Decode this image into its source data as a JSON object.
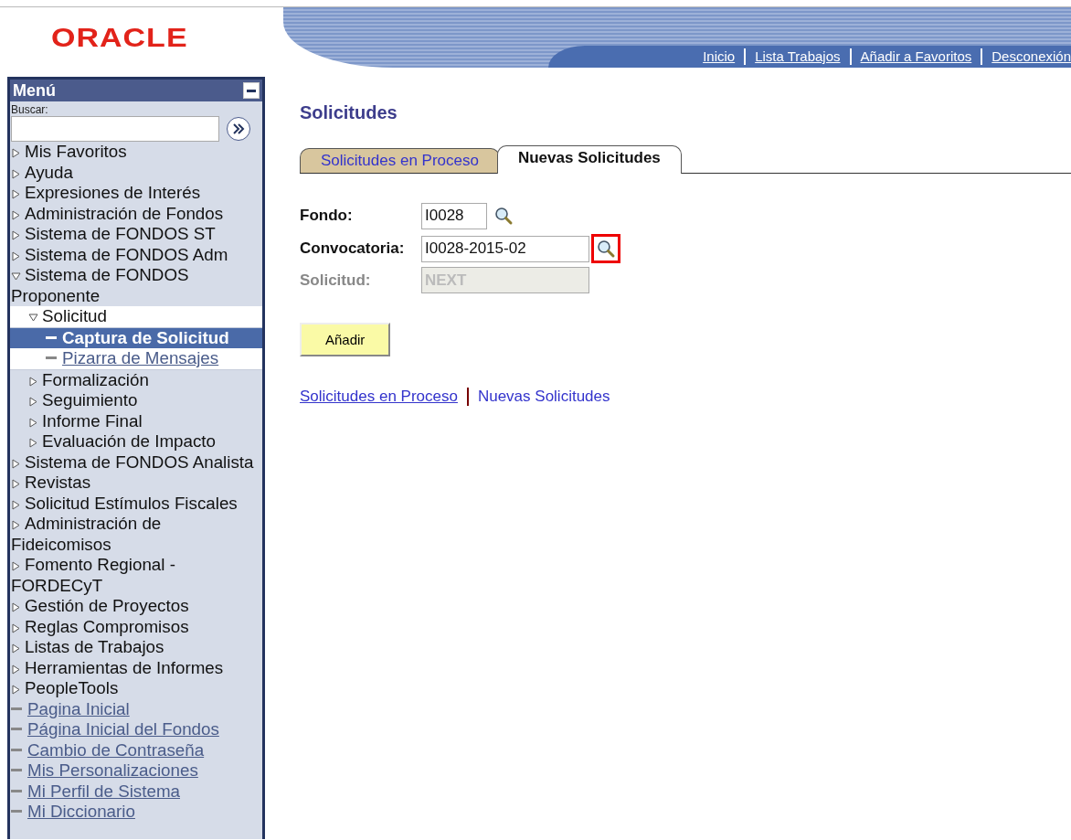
{
  "header": {
    "logo": "ORACLE",
    "links": [
      "Inicio",
      "Lista Trabajos",
      "Añadir a Favoritos",
      "Desconexión"
    ]
  },
  "menu": {
    "title": "Menú",
    "search_label": "Buscar:",
    "items": [
      {
        "label": "Mis Favoritos",
        "kind": "folder",
        "expanded": false,
        "selected": false
      },
      {
        "label": "Ayuda",
        "kind": "folder",
        "expanded": false,
        "selected": false
      },
      {
        "label": "Expresiones de Interés",
        "kind": "folder",
        "expanded": false,
        "selected": false
      },
      {
        "label": "Administración de Fondos",
        "kind": "folder",
        "expanded": false,
        "selected": false
      },
      {
        "label": "Sistema de FONDOS ST",
        "kind": "folder",
        "expanded": false,
        "selected": false
      },
      {
        "label": "Sistema de FONDOS Adm",
        "kind": "folder",
        "expanded": false,
        "selected": false
      },
      {
        "label": "Sistema de FONDOS Proponente",
        "kind": "folder",
        "expanded": true,
        "selected": false,
        "children": [
          {
            "label": "Solicitud",
            "kind": "folder",
            "expanded": true,
            "selected": false,
            "children": [
              {
                "label": "Captura de Solicitud",
                "kind": "link",
                "selected": true
              },
              {
                "label": "Pizarra de Mensajes",
                "kind": "link",
                "selected": false
              }
            ]
          },
          {
            "label": "Formalización",
            "kind": "folder",
            "expanded": false,
            "selected": false
          },
          {
            "label": "Seguimiento",
            "kind": "folder",
            "expanded": false,
            "selected": false
          },
          {
            "label": "Informe Final",
            "kind": "folder",
            "expanded": false,
            "selected": false
          },
          {
            "label": "Evaluación de Impacto",
            "kind": "folder",
            "expanded": false,
            "selected": false
          }
        ]
      },
      {
        "label": "Sistema de FONDOS Analista",
        "kind": "folder",
        "expanded": false,
        "selected": false
      },
      {
        "label": "Revistas",
        "kind": "folder",
        "expanded": false,
        "selected": false
      },
      {
        "label": "Solicitud Estímulos Fiscales",
        "kind": "folder",
        "expanded": false,
        "selected": false
      },
      {
        "label": "Administración de Fideicomisos",
        "kind": "folder",
        "expanded": false,
        "selected": false
      },
      {
        "label": "Fomento Regional - FORDECyT",
        "kind": "folder",
        "expanded": false,
        "selected": false
      },
      {
        "label": "Gestión de Proyectos",
        "kind": "folder",
        "expanded": false,
        "selected": false
      },
      {
        "label": "Reglas Compromisos",
        "kind": "folder",
        "expanded": false,
        "selected": false
      },
      {
        "label": "Listas de Trabajos",
        "kind": "folder",
        "expanded": false,
        "selected": false
      },
      {
        "label": "Herramientas de Informes",
        "kind": "folder",
        "expanded": false,
        "selected": false
      },
      {
        "label": "PeopleTools",
        "kind": "folder",
        "expanded": false,
        "selected": false
      },
      {
        "label": "Pagina Inicial",
        "kind": "link",
        "selected": false
      },
      {
        "label": "Página Inicial del Fondos",
        "kind": "link",
        "selected": false
      },
      {
        "label": "Cambio de Contraseña",
        "kind": "link",
        "selected": false
      },
      {
        "label": "Mis Personalizaciones",
        "kind": "link",
        "selected": false
      },
      {
        "label": "Mi Perfil de Sistema",
        "kind": "link",
        "selected": false
      },
      {
        "label": "Mi Diccionario",
        "kind": "link",
        "selected": false
      }
    ]
  },
  "page": {
    "title": "Solicitudes",
    "tabs": [
      {
        "label": "Solicitudes en Proceso",
        "selected": false
      },
      {
        "label": "Nuevas Solicitudes",
        "selected": true
      }
    ],
    "fields": [
      {
        "label": "Fondo:",
        "value": "I0028",
        "disabled": false,
        "lookup": true,
        "highlighted": false
      },
      {
        "label": "Convocatoria:",
        "value": "I0028-2015-02",
        "disabled": false,
        "lookup": true,
        "highlighted": true
      },
      {
        "label": "Solicitud:",
        "value": "NEXT",
        "disabled": true,
        "lookup": false
      }
    ],
    "button": "Añadir",
    "bottom_links": [
      "Solicitudes en Proceso",
      "Nuevas Solicitudes"
    ]
  }
}
